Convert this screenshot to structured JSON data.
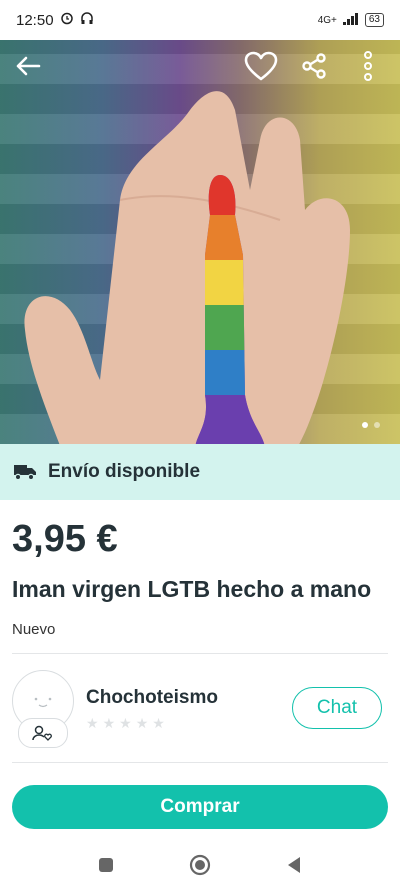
{
  "status_bar": {
    "time": "12:50",
    "network": "4G+",
    "battery": "63"
  },
  "hero": {
    "icons": [
      "back-arrow-icon",
      "heart-icon",
      "share-icon",
      "more-vertical-icon"
    ],
    "pagination": {
      "total": 2,
      "active": 0
    }
  },
  "shipping": {
    "label": "Envío disponible",
    "icon": "truck-icon"
  },
  "product": {
    "price": "3,95 €",
    "title": "Iman virgen LGTB hecho a mano",
    "condition": "Nuevo"
  },
  "seller": {
    "name": "Chochoteismo",
    "rating_stars": 0,
    "rating_max": 5,
    "chat_label": "Chat"
  },
  "actions": {
    "buy_label": "Comprar"
  },
  "colors": {
    "accent": "#13c1ac",
    "shipping_bg": "#d3f3ee",
    "text": "#253238"
  }
}
